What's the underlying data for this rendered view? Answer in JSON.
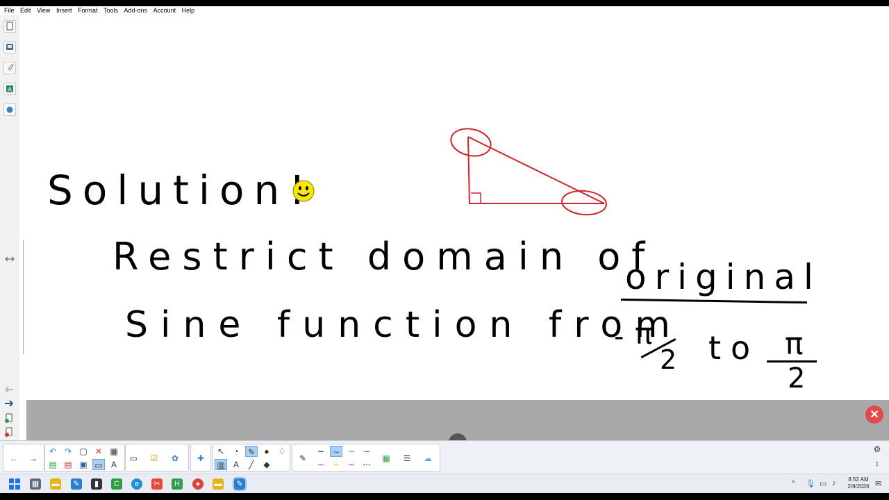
{
  "menu": {
    "items": [
      "File",
      "Edit",
      "View",
      "Insert",
      "Format",
      "Tools",
      "Add-ons",
      "Account",
      "Help"
    ]
  },
  "canvas": {
    "line1": "Solution!",
    "line2": "Restrict domain of",
    "line2_emph": "original",
    "line3": "Sine function from",
    "neg": "-",
    "pi": "π",
    "den": "2",
    "to": "to"
  },
  "icons": {
    "smiley": "smiley-face",
    "close": "close-icon"
  },
  "colors": {
    "ink": "#000000",
    "shape": "#d0232a",
    "close": "#e24b4b",
    "selected": "#a9cff3"
  },
  "taskbar": {
    "time": "8:52 AM",
    "date": "2/9/2026"
  }
}
